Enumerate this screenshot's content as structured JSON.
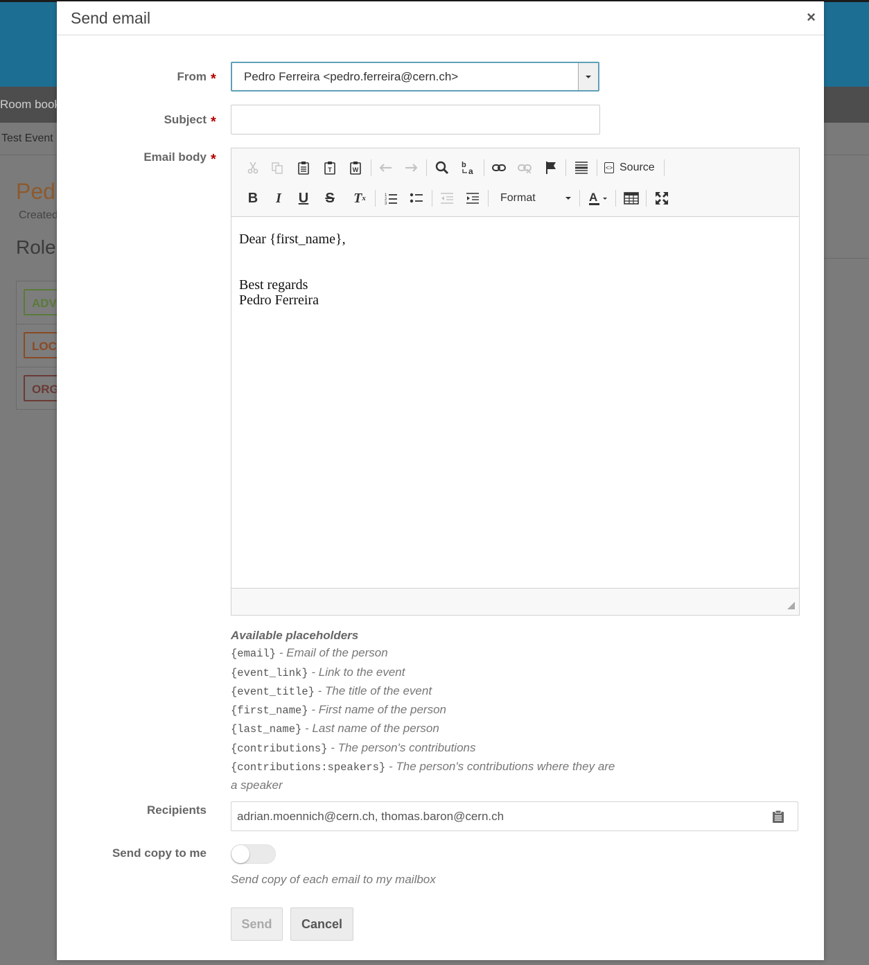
{
  "background": {
    "nav_text": "Room book",
    "breadcrumb": "Test Event",
    "person_title": "Ped",
    "created_text": "Created",
    "roles_heading": "Role",
    "roles": [
      "ADV",
      "LOC",
      "ORG"
    ]
  },
  "modal": {
    "title": "Send email",
    "close_icon": "×",
    "from": {
      "label": "From",
      "value": "Pedro Ferreira <pedro.ferreira@cern.ch>"
    },
    "subject": {
      "label": "Subject",
      "value": "",
      "placeholder": ""
    },
    "body": {
      "label": "Email body",
      "lines": [
        "Dear {first_name},",
        "Best regards",
        "Pedro Ferreira"
      ]
    },
    "toolbar": {
      "source_label": "Source",
      "format_label": "Format"
    },
    "placeholders": {
      "title": "Available placeholders",
      "items": [
        {
          "code": "{email}",
          "desc": "Email of the person"
        },
        {
          "code": "{event_link}",
          "desc": "Link to the event"
        },
        {
          "code": "{event_title}",
          "desc": "The title of the event"
        },
        {
          "code": "{first_name}",
          "desc": "First name of the person"
        },
        {
          "code": "{last_name}",
          "desc": "Last name of the person"
        },
        {
          "code": "{contributions}",
          "desc": "The person's contributions"
        },
        {
          "code": "{contributions:speakers}",
          "desc": "The person's contributions where they are a speaker"
        }
      ]
    },
    "recipients": {
      "label": "Recipients",
      "value": "adrian.moennich@cern.ch, thomas.baron@cern.ch"
    },
    "send_copy": {
      "label": "Send copy to me",
      "help": "Send copy of each email to my mailbox",
      "enabled": false
    },
    "buttons": {
      "send": "Send",
      "cancel": "Cancel"
    }
  },
  "colors": {
    "required_star": "#b30000",
    "header_blue": "#1c6f93",
    "focus_border": "#5fa0b8"
  }
}
